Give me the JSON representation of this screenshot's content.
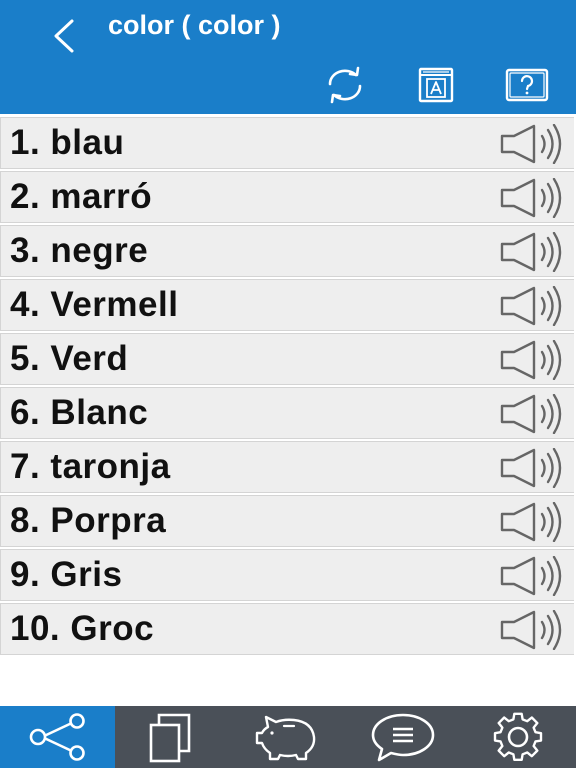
{
  "header": {
    "title": "color ( color )",
    "icons": [
      "back-chevron-icon",
      "refresh-icon",
      "dictionary-icon",
      "help-icon"
    ]
  },
  "list": {
    "items": [
      {
        "label": "1. blau"
      },
      {
        "label": "2. marró"
      },
      {
        "label": "3. negre"
      },
      {
        "label": "4. Vermell"
      },
      {
        "label": "5. Verd"
      },
      {
        "label": "6. Blanc"
      },
      {
        "label": "7. taronja"
      },
      {
        "label": "8. Porpra"
      },
      {
        "label": "9. Gris"
      },
      {
        "label": "10. Groc"
      }
    ],
    "item_icon": "speaker-icon"
  },
  "tabbar": {
    "tabs": [
      {
        "icon": "share-icon",
        "active": true
      },
      {
        "icon": "cards-icon",
        "active": false
      },
      {
        "icon": "piggy-bank-icon",
        "active": false
      },
      {
        "icon": "chat-bubble-icon",
        "active": false
      },
      {
        "icon": "settings-gear-icon",
        "active": false
      }
    ]
  },
  "colors": {
    "header_bg": "#1a7ec9",
    "row_bg": "#eeeeee",
    "tabbar_bg": "#4a5058",
    "tab_active_bg": "#1a7ec9",
    "icon_fg": "#ffffff"
  }
}
